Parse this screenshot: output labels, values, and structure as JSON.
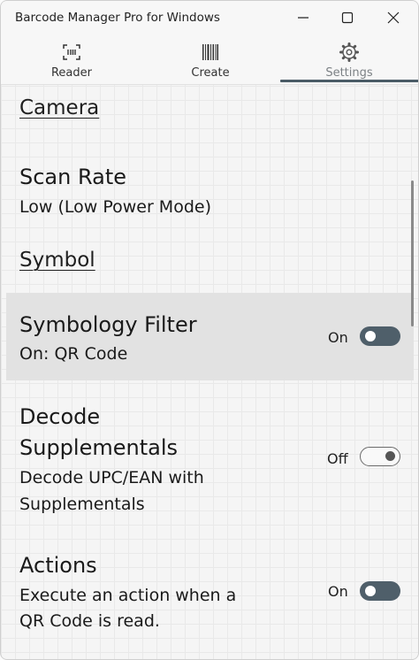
{
  "window": {
    "title": "Barcode Manager Pro for Windows"
  },
  "caption_buttons": {
    "minimize": "minimize-icon",
    "maximize": "maximize-icon",
    "close": "close-icon"
  },
  "nav": {
    "tabs": [
      {
        "label": "Reader",
        "icon": "scan-icon",
        "active": false
      },
      {
        "label": "Create",
        "icon": "barcode-icon",
        "active": false
      },
      {
        "label": "Settings",
        "icon": "gear-icon",
        "active": true
      }
    ]
  },
  "sections": {
    "camera": {
      "header": "Camera"
    },
    "symbol": {
      "header": "Symbol"
    }
  },
  "settings": {
    "scan_rate": {
      "title": "Scan Rate",
      "value": "Low (Low Power Mode)"
    },
    "symbology_filter": {
      "title": "Symbology Filter",
      "value": "On: QR Code",
      "toggle_label": "On",
      "toggle_on": true
    },
    "decode_supplementals": {
      "title_line1": "Decode",
      "title_line2": "Supplementals",
      "desc_line1": "Decode UPC/EAN with",
      "desc_line2": "Supplementals",
      "toggle_label": "Off",
      "toggle_on": false
    },
    "actions": {
      "title": "Actions",
      "desc_line1": "Execute an action when a",
      "desc_line2": "QR Code is read.",
      "toggle_label": "On",
      "toggle_on": true
    }
  },
  "colors": {
    "accent": "#4a5b66",
    "toggle_on": "#4f5f6a",
    "highlight": "#e2e2e2"
  }
}
